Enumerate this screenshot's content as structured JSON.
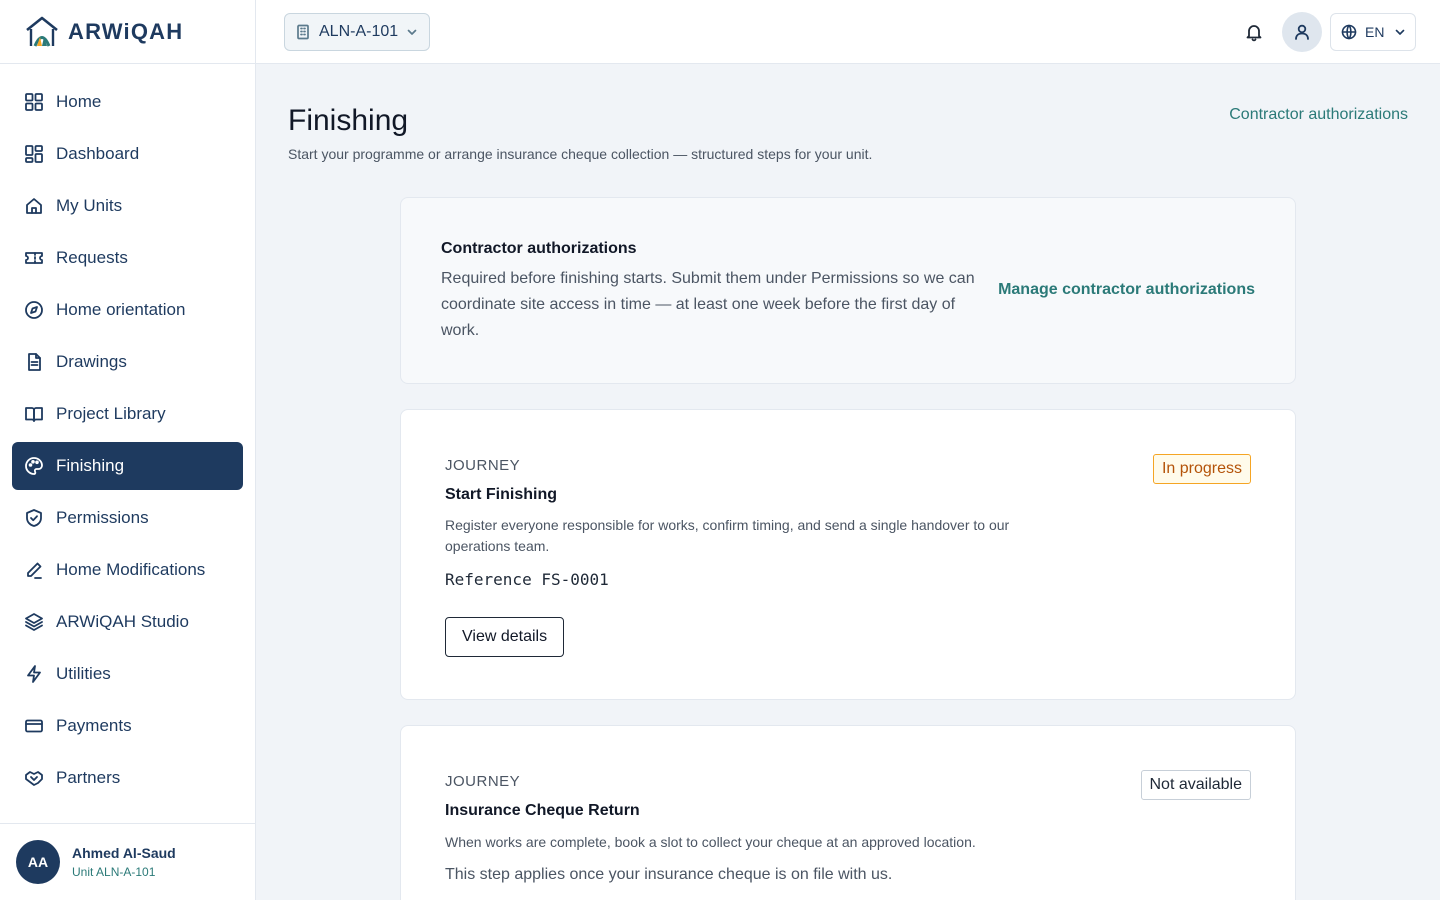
{
  "brand": {
    "name": "ARWiQAH",
    "logo_icon": "arwiqah-logo"
  },
  "topbar": {
    "unit_selector": "ALN-A-101",
    "language": "EN",
    "icons": [
      "building-icon",
      "chevron-down-icon",
      "bell-icon",
      "user-icon",
      "globe-icon"
    ]
  },
  "sidebar": {
    "items": [
      {
        "label": "Home",
        "icon": "grid-icon"
      },
      {
        "label": "Dashboard",
        "icon": "dashboard-icon"
      },
      {
        "label": "My Units",
        "icon": "house-icon"
      },
      {
        "label": "Requests",
        "icon": "ticket-icon"
      },
      {
        "label": "Home orientation",
        "icon": "compass-icon"
      },
      {
        "label": "Drawings",
        "icon": "document-icon"
      },
      {
        "label": "Project Library",
        "icon": "book-icon"
      },
      {
        "label": "Finishing",
        "icon": "palette-icon",
        "active": true
      },
      {
        "label": "Permissions",
        "icon": "shield-check-icon"
      },
      {
        "label": "Home Modifications",
        "icon": "pen-icon"
      },
      {
        "label": "ARWiQAH Studio",
        "icon": "layers-icon"
      },
      {
        "label": "Utilities",
        "icon": "bolt-icon"
      },
      {
        "label": "Payments",
        "icon": "card-icon"
      },
      {
        "label": "Partners",
        "icon": "handshake-icon"
      }
    ],
    "user": {
      "initials": "AA",
      "name": "Ahmed Al-Saud",
      "unit": "Unit ALN-A-101"
    }
  },
  "main": {
    "title": "Finishing",
    "subtitle": "Start your programme or arrange insurance cheque collection — structured steps for your unit.",
    "header_link": "Contractor authorizations",
    "auth_card": {
      "title": "Contractor authorizations",
      "text": "Required before finishing starts. Submit them under Permissions so we can coordinate site access in time — at least one week before the first day of work.",
      "link": "Manage contractor authorizations"
    },
    "journeys": [
      {
        "eyebrow": "JOURNEY",
        "title": "Start Finishing",
        "description": "Register everyone responsible for works, confirm timing, and send a single handover to our operations team.",
        "reference": "Reference FS-0001",
        "button": "View details",
        "status": "In progress",
        "status_color": "#b45309"
      },
      {
        "eyebrow": "JOURNEY",
        "title": "Insurance Cheque Return",
        "description": "When works are complete, book a slot to collect your cheque at an approved location.",
        "note": "This step applies once your insurance cheque is on file with us.",
        "status": "Not available",
        "status_color": "#1f2937"
      }
    ]
  },
  "colors": {
    "primary": "#1e3a5f",
    "accent": "#2b7a78",
    "background": "#f1f4f8"
  }
}
